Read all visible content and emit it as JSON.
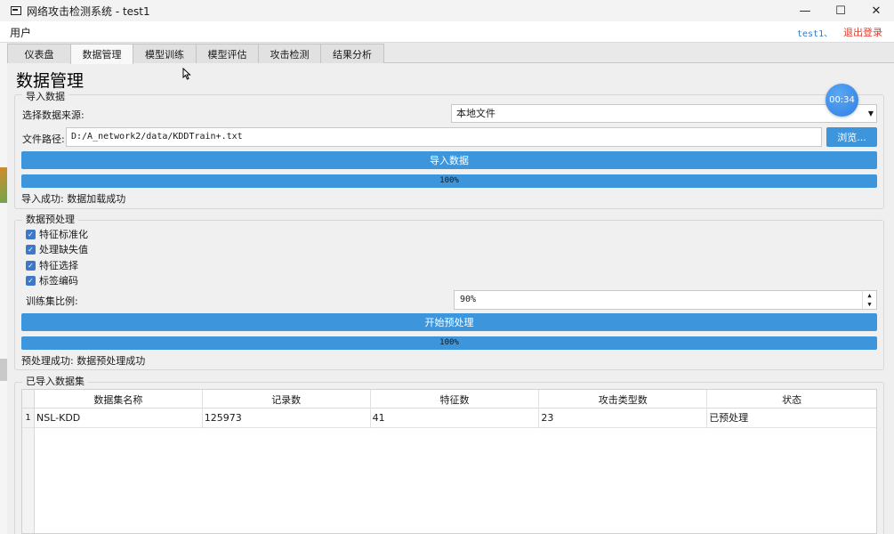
{
  "window": {
    "title": "网络攻击检测系统 - test1",
    "minimize": "—",
    "maximize": "☐",
    "close": "✕"
  },
  "menubar": {
    "user_menu": "用户",
    "current_user": "test1、",
    "logout": "退出登录"
  },
  "tabs": [
    {
      "label": "仪表盘",
      "active": false
    },
    {
      "label": "数据管理",
      "active": true
    },
    {
      "label": "模型训练",
      "active": false
    },
    {
      "label": "模型评估",
      "active": false
    },
    {
      "label": "攻击检测",
      "active": false
    },
    {
      "label": "结果分析",
      "active": false
    }
  ],
  "page_title": "数据管理",
  "timer": "00:34",
  "import": {
    "title": "导入数据",
    "source_label": "选择数据来源:",
    "source_value": "本地文件",
    "path_label": "文件路径:",
    "path_value": "D:/A_network2/data/KDDTrain+.txt",
    "browse_label": "浏览...",
    "import_button": "导入数据",
    "progress": 100,
    "progress_text": "100%",
    "status": "导入成功: 数据加载成功"
  },
  "preprocess": {
    "title": "数据预处理",
    "options": [
      {
        "label": "特征标准化",
        "checked": true
      },
      {
        "label": "处理缺失值",
        "checked": true
      },
      {
        "label": "特征选择",
        "checked": true
      },
      {
        "label": "标签编码",
        "checked": true
      }
    ],
    "ratio_label": "训练集比例:",
    "ratio_value": "90%",
    "start_button": "开始预处理",
    "progress": 100,
    "progress_text": "100%",
    "status": "预处理成功: 数据预处理成功"
  },
  "datasets": {
    "title": "已导入数据集",
    "columns": [
      "数据集名称",
      "记录数",
      "特征数",
      "攻击类型数",
      "状态"
    ],
    "rows": [
      {
        "index": "1",
        "cells": [
          "NSL-KDD",
          "125973",
          "41",
          "23",
          "已预处理"
        ]
      }
    ]
  },
  "colors": {
    "accent": "#3d95db",
    "logout": "#e23b2b",
    "user_link": "#2f7bd0"
  }
}
